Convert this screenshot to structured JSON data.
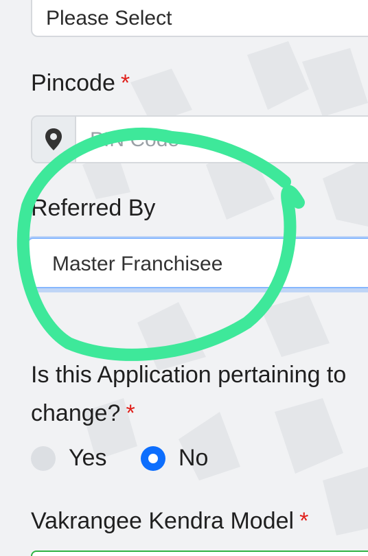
{
  "fields": {
    "state_select": {
      "value": "Please Select"
    },
    "pincode": {
      "label": "Pincode",
      "required_mark": "*",
      "placeholder": "PIN Code",
      "icon": "map-pin-icon"
    },
    "referred_by": {
      "label": "Referred By",
      "value": "Master Franchisee"
    },
    "application_question": {
      "line1": "Is this Application pertaining to",
      "line2": "change?",
      "required_mark": "*",
      "options": [
        {
          "label": "Yes",
          "selected": false
        },
        {
          "label": "No",
          "selected": true
        }
      ]
    },
    "kendra_model": {
      "label": "Vakrangee Kendra Model",
      "required_mark": "*"
    }
  },
  "colors": {
    "required": "#e0201b",
    "radio_selected": "#0d6efd",
    "focus_border": "#86b7fe",
    "annotation_stroke": "#3ee89a"
  }
}
